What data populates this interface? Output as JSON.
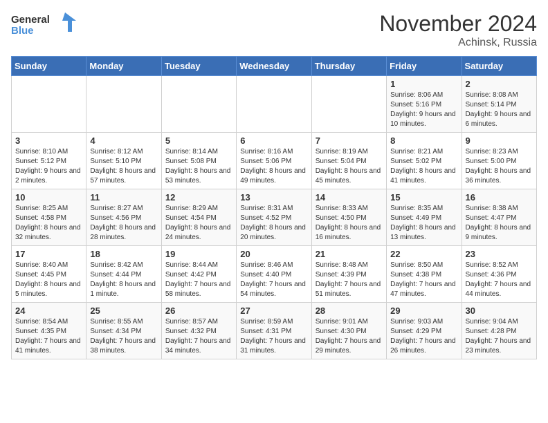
{
  "header": {
    "logo_general": "General",
    "logo_blue": "Blue",
    "title": "November 2024",
    "location": "Achinsk, Russia"
  },
  "weekdays": [
    "Sunday",
    "Monday",
    "Tuesday",
    "Wednesday",
    "Thursday",
    "Friday",
    "Saturday"
  ],
  "weeks": [
    [
      {
        "day": "",
        "info": ""
      },
      {
        "day": "",
        "info": ""
      },
      {
        "day": "",
        "info": ""
      },
      {
        "day": "",
        "info": ""
      },
      {
        "day": "",
        "info": ""
      },
      {
        "day": "1",
        "info": "Sunrise: 8:06 AM\nSunset: 5:16 PM\nDaylight: 9 hours and 10 minutes."
      },
      {
        "day": "2",
        "info": "Sunrise: 8:08 AM\nSunset: 5:14 PM\nDaylight: 9 hours and 6 minutes."
      }
    ],
    [
      {
        "day": "3",
        "info": "Sunrise: 8:10 AM\nSunset: 5:12 PM\nDaylight: 9 hours and 2 minutes."
      },
      {
        "day": "4",
        "info": "Sunrise: 8:12 AM\nSunset: 5:10 PM\nDaylight: 8 hours and 57 minutes."
      },
      {
        "day": "5",
        "info": "Sunrise: 8:14 AM\nSunset: 5:08 PM\nDaylight: 8 hours and 53 minutes."
      },
      {
        "day": "6",
        "info": "Sunrise: 8:16 AM\nSunset: 5:06 PM\nDaylight: 8 hours and 49 minutes."
      },
      {
        "day": "7",
        "info": "Sunrise: 8:19 AM\nSunset: 5:04 PM\nDaylight: 8 hours and 45 minutes."
      },
      {
        "day": "8",
        "info": "Sunrise: 8:21 AM\nSunset: 5:02 PM\nDaylight: 8 hours and 41 minutes."
      },
      {
        "day": "9",
        "info": "Sunrise: 8:23 AM\nSunset: 5:00 PM\nDaylight: 8 hours and 36 minutes."
      }
    ],
    [
      {
        "day": "10",
        "info": "Sunrise: 8:25 AM\nSunset: 4:58 PM\nDaylight: 8 hours and 32 minutes."
      },
      {
        "day": "11",
        "info": "Sunrise: 8:27 AM\nSunset: 4:56 PM\nDaylight: 8 hours and 28 minutes."
      },
      {
        "day": "12",
        "info": "Sunrise: 8:29 AM\nSunset: 4:54 PM\nDaylight: 8 hours and 24 minutes."
      },
      {
        "day": "13",
        "info": "Sunrise: 8:31 AM\nSunset: 4:52 PM\nDaylight: 8 hours and 20 minutes."
      },
      {
        "day": "14",
        "info": "Sunrise: 8:33 AM\nSunset: 4:50 PM\nDaylight: 8 hours and 16 minutes."
      },
      {
        "day": "15",
        "info": "Sunrise: 8:35 AM\nSunset: 4:49 PM\nDaylight: 8 hours and 13 minutes."
      },
      {
        "day": "16",
        "info": "Sunrise: 8:38 AM\nSunset: 4:47 PM\nDaylight: 8 hours and 9 minutes."
      }
    ],
    [
      {
        "day": "17",
        "info": "Sunrise: 8:40 AM\nSunset: 4:45 PM\nDaylight: 8 hours and 5 minutes."
      },
      {
        "day": "18",
        "info": "Sunrise: 8:42 AM\nSunset: 4:44 PM\nDaylight: 8 hours and 1 minute."
      },
      {
        "day": "19",
        "info": "Sunrise: 8:44 AM\nSunset: 4:42 PM\nDaylight: 7 hours and 58 minutes."
      },
      {
        "day": "20",
        "info": "Sunrise: 8:46 AM\nSunset: 4:40 PM\nDaylight: 7 hours and 54 minutes."
      },
      {
        "day": "21",
        "info": "Sunrise: 8:48 AM\nSunset: 4:39 PM\nDaylight: 7 hours and 51 minutes."
      },
      {
        "day": "22",
        "info": "Sunrise: 8:50 AM\nSunset: 4:38 PM\nDaylight: 7 hours and 47 minutes."
      },
      {
        "day": "23",
        "info": "Sunrise: 8:52 AM\nSunset: 4:36 PM\nDaylight: 7 hours and 44 minutes."
      }
    ],
    [
      {
        "day": "24",
        "info": "Sunrise: 8:54 AM\nSunset: 4:35 PM\nDaylight: 7 hours and 41 minutes."
      },
      {
        "day": "25",
        "info": "Sunrise: 8:55 AM\nSunset: 4:34 PM\nDaylight: 7 hours and 38 minutes."
      },
      {
        "day": "26",
        "info": "Sunrise: 8:57 AM\nSunset: 4:32 PM\nDaylight: 7 hours and 34 minutes."
      },
      {
        "day": "27",
        "info": "Sunrise: 8:59 AM\nSunset: 4:31 PM\nDaylight: 7 hours and 31 minutes."
      },
      {
        "day": "28",
        "info": "Sunrise: 9:01 AM\nSunset: 4:30 PM\nDaylight: 7 hours and 29 minutes."
      },
      {
        "day": "29",
        "info": "Sunrise: 9:03 AM\nSunset: 4:29 PM\nDaylight: 7 hours and 26 minutes."
      },
      {
        "day": "30",
        "info": "Sunrise: 9:04 AM\nSunset: 4:28 PM\nDaylight: 7 hours and 23 minutes."
      }
    ]
  ]
}
